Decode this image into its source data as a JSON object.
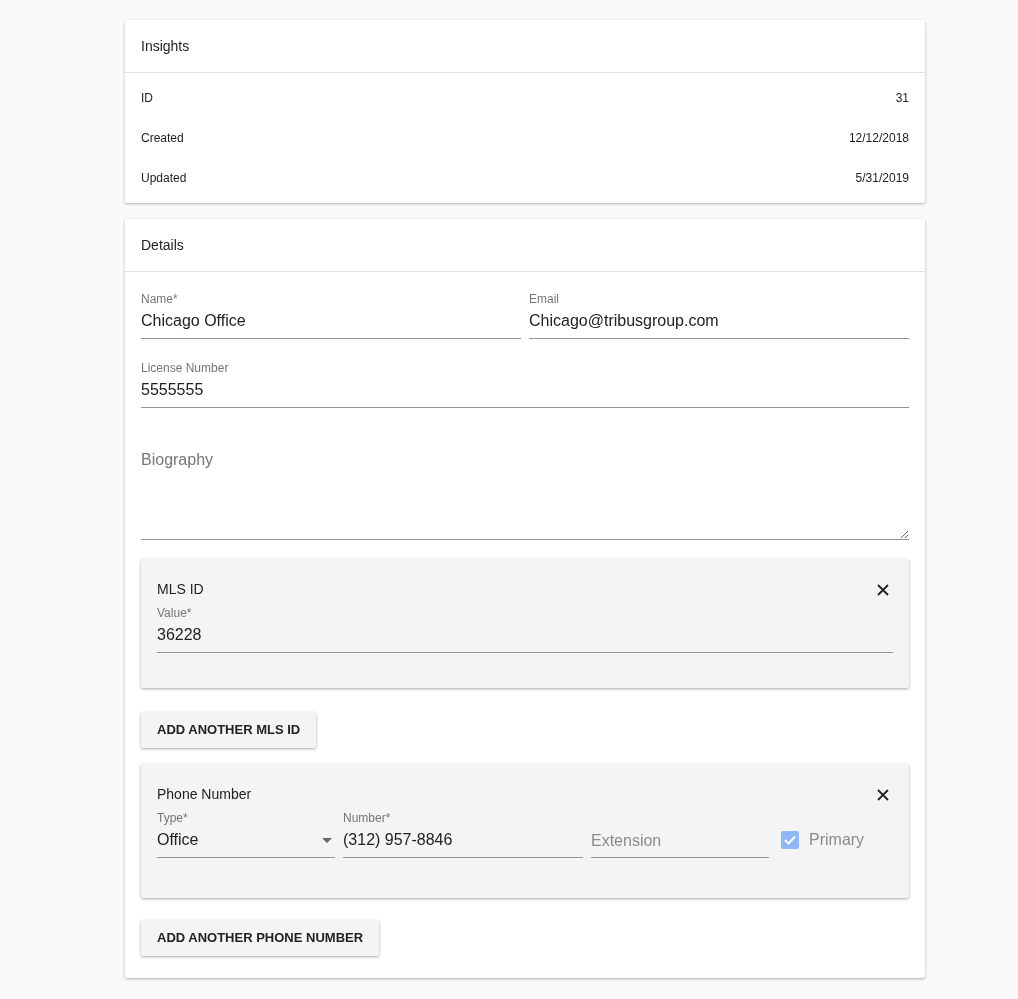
{
  "insights": {
    "title": "Insights",
    "rows": [
      {
        "label": "ID",
        "value": "31"
      },
      {
        "label": "Created",
        "value": "12/12/2018"
      },
      {
        "label": "Updated",
        "value": "5/31/2019"
      }
    ]
  },
  "details": {
    "title": "Details",
    "name": {
      "label": "Name*",
      "value": "Chicago Office"
    },
    "email": {
      "label": "Email",
      "value": "Chicago@tribusgroup.com"
    },
    "license": {
      "label": "License Number",
      "value": "5555555"
    },
    "biography": {
      "placeholder": "Biography"
    },
    "mls": {
      "title": "MLS ID",
      "field": {
        "label": "Value*",
        "value": "36228"
      }
    },
    "add_mls_button": "ADD ANOTHER MLS ID",
    "phone": {
      "title": "Phone Number",
      "type": {
        "label": "Type*",
        "value": "Office"
      },
      "number": {
        "label": "Number*",
        "value": "(312) 957-8846"
      },
      "extension": {
        "placeholder": "Extension"
      },
      "primary": {
        "label": "Primary",
        "checked": true
      }
    },
    "add_phone_button": "ADD ANOTHER PHONE NUMBER"
  }
}
